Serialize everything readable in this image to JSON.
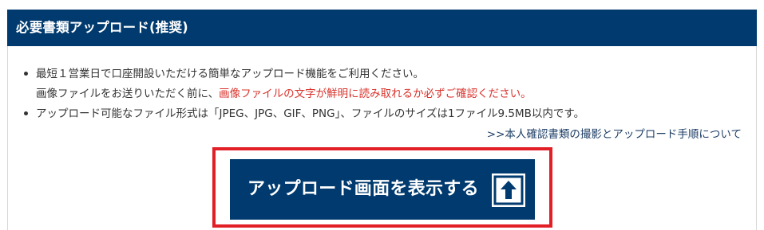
{
  "header": {
    "title": "必要書類アップロード(推奨)"
  },
  "info": {
    "bullet1_line1": "最短１営業日で口座開設いただける簡単なアップロード機能をご利用ください。",
    "bullet1_line2_prefix": "画像ファイルをお送りいただく前に、",
    "bullet1_line2_warning": "画像ファイルの文字が鮮明に読み取れるか必ずご確認ください。",
    "bullet2": "アップロード可能なファイル形式は「JPEG、JPG、GIF、PNG」、ファイルのサイズは1ファイル9.5MB以内です。",
    "guide_link": ">>本人確認書類の撮影とアップロード手順について"
  },
  "upload": {
    "button_label": "アップロード画面を表示する",
    "icon": "upload-arrow-icon"
  },
  "colors": {
    "header_bg": "#003a6e",
    "warning_text": "#d9332c",
    "highlight_border": "#e21f26",
    "link_text": "#1e3f66"
  }
}
